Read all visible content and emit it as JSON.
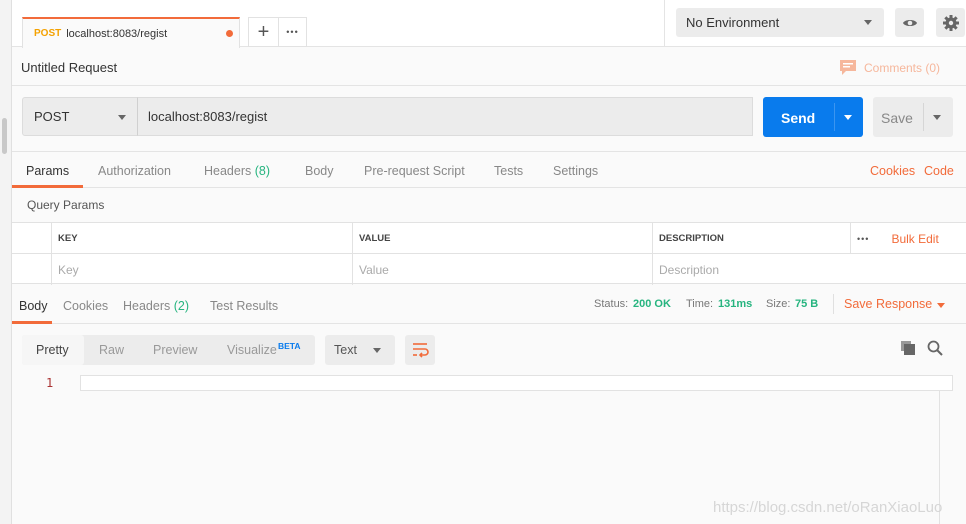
{
  "tab": {
    "method": "POST",
    "url": "localhost:8083/regist",
    "unsaved": true
  },
  "tab_actions": {
    "add": "+",
    "more": "•••"
  },
  "environment": {
    "selected": "No Environment"
  },
  "request": {
    "title": "Untitled Request",
    "comments": "Comments (0)",
    "method": "POST",
    "url": "localhost:8083/regist",
    "send": "Send",
    "save": "Save"
  },
  "request_tabs": [
    {
      "label": "Params",
      "active": true
    },
    {
      "label": "Authorization"
    },
    {
      "label": "Headers",
      "count": "(8)"
    },
    {
      "label": "Body"
    },
    {
      "label": "Pre-request Script"
    },
    {
      "label": "Tests"
    },
    {
      "label": "Settings"
    }
  ],
  "request_links": {
    "cookies": "Cookies",
    "code": "Code"
  },
  "query_params": {
    "title": "Query Params",
    "headers": [
      "KEY",
      "VALUE",
      "DESCRIPTION"
    ],
    "placeholders": [
      "Key",
      "Value",
      "Description"
    ],
    "more": "•••",
    "bulk_edit": "Bulk Edit"
  },
  "response_tabs": [
    {
      "label": "Body",
      "active": true
    },
    {
      "label": "Cookies"
    },
    {
      "label": "Headers",
      "count": "(2)"
    },
    {
      "label": "Test Results"
    }
  ],
  "response_meta": {
    "status_label": "Status:",
    "status": "200 OK",
    "time_label": "Time:",
    "time": "131ms",
    "size_label": "Size:",
    "size": "75 B",
    "save_response": "Save Response"
  },
  "body_view": {
    "modes": [
      "Pretty",
      "Raw",
      "Preview",
      "Visualize"
    ],
    "beta": "BETA",
    "format": "Text",
    "line_numbers": [
      "1"
    ]
  },
  "watermark": "https://blog.csdn.net/oRanXiaoLuo",
  "colors": {
    "accent": "#f26b3a",
    "send": "#097bed",
    "success": "#26b47f"
  }
}
